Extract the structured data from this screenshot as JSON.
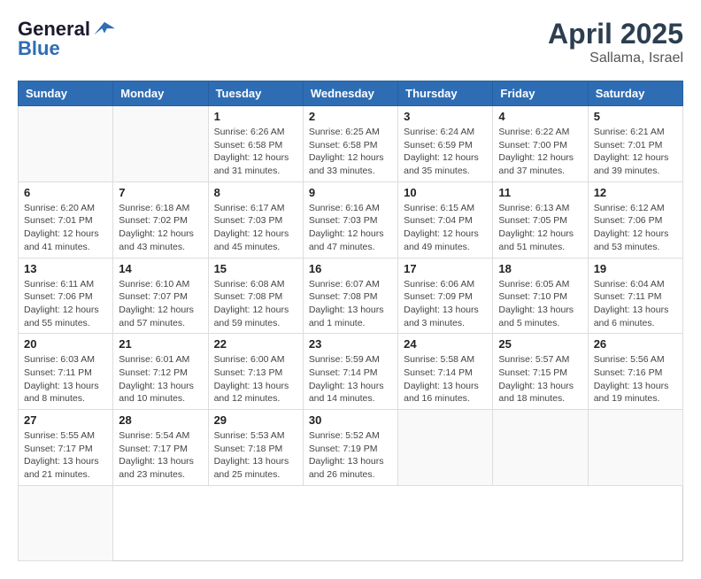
{
  "logo": {
    "general": "General",
    "blue": "Blue"
  },
  "header": {
    "month": "April 2025",
    "location": "Sallama, Israel"
  },
  "weekdays": [
    "Sunday",
    "Monday",
    "Tuesday",
    "Wednesday",
    "Thursday",
    "Friday",
    "Saturday"
  ],
  "days": [
    {
      "date": null,
      "info": null
    },
    {
      "date": null,
      "info": null
    },
    {
      "date": "1",
      "info": "Sunrise: 6:26 AM\nSunset: 6:58 PM\nDaylight: 12 hours\nand 31 minutes."
    },
    {
      "date": "2",
      "info": "Sunrise: 6:25 AM\nSunset: 6:58 PM\nDaylight: 12 hours\nand 33 minutes."
    },
    {
      "date": "3",
      "info": "Sunrise: 6:24 AM\nSunset: 6:59 PM\nDaylight: 12 hours\nand 35 minutes."
    },
    {
      "date": "4",
      "info": "Sunrise: 6:22 AM\nSunset: 7:00 PM\nDaylight: 12 hours\nand 37 minutes."
    },
    {
      "date": "5",
      "info": "Sunrise: 6:21 AM\nSunset: 7:01 PM\nDaylight: 12 hours\nand 39 minutes."
    },
    {
      "date": "6",
      "info": "Sunrise: 6:20 AM\nSunset: 7:01 PM\nDaylight: 12 hours\nand 41 minutes."
    },
    {
      "date": "7",
      "info": "Sunrise: 6:18 AM\nSunset: 7:02 PM\nDaylight: 12 hours\nand 43 minutes."
    },
    {
      "date": "8",
      "info": "Sunrise: 6:17 AM\nSunset: 7:03 PM\nDaylight: 12 hours\nand 45 minutes."
    },
    {
      "date": "9",
      "info": "Sunrise: 6:16 AM\nSunset: 7:03 PM\nDaylight: 12 hours\nand 47 minutes."
    },
    {
      "date": "10",
      "info": "Sunrise: 6:15 AM\nSunset: 7:04 PM\nDaylight: 12 hours\nand 49 minutes."
    },
    {
      "date": "11",
      "info": "Sunrise: 6:13 AM\nSunset: 7:05 PM\nDaylight: 12 hours\nand 51 minutes."
    },
    {
      "date": "12",
      "info": "Sunrise: 6:12 AM\nSunset: 7:06 PM\nDaylight: 12 hours\nand 53 minutes."
    },
    {
      "date": "13",
      "info": "Sunrise: 6:11 AM\nSunset: 7:06 PM\nDaylight: 12 hours\nand 55 minutes."
    },
    {
      "date": "14",
      "info": "Sunrise: 6:10 AM\nSunset: 7:07 PM\nDaylight: 12 hours\nand 57 minutes."
    },
    {
      "date": "15",
      "info": "Sunrise: 6:08 AM\nSunset: 7:08 PM\nDaylight: 12 hours\nand 59 minutes."
    },
    {
      "date": "16",
      "info": "Sunrise: 6:07 AM\nSunset: 7:08 PM\nDaylight: 13 hours\nand 1 minute."
    },
    {
      "date": "17",
      "info": "Sunrise: 6:06 AM\nSunset: 7:09 PM\nDaylight: 13 hours\nand 3 minutes."
    },
    {
      "date": "18",
      "info": "Sunrise: 6:05 AM\nSunset: 7:10 PM\nDaylight: 13 hours\nand 5 minutes."
    },
    {
      "date": "19",
      "info": "Sunrise: 6:04 AM\nSunset: 7:11 PM\nDaylight: 13 hours\nand 6 minutes."
    },
    {
      "date": "20",
      "info": "Sunrise: 6:03 AM\nSunset: 7:11 PM\nDaylight: 13 hours\nand 8 minutes."
    },
    {
      "date": "21",
      "info": "Sunrise: 6:01 AM\nSunset: 7:12 PM\nDaylight: 13 hours\nand 10 minutes."
    },
    {
      "date": "22",
      "info": "Sunrise: 6:00 AM\nSunset: 7:13 PM\nDaylight: 13 hours\nand 12 minutes."
    },
    {
      "date": "23",
      "info": "Sunrise: 5:59 AM\nSunset: 7:14 PM\nDaylight: 13 hours\nand 14 minutes."
    },
    {
      "date": "24",
      "info": "Sunrise: 5:58 AM\nSunset: 7:14 PM\nDaylight: 13 hours\nand 16 minutes."
    },
    {
      "date": "25",
      "info": "Sunrise: 5:57 AM\nSunset: 7:15 PM\nDaylight: 13 hours\nand 18 minutes."
    },
    {
      "date": "26",
      "info": "Sunrise: 5:56 AM\nSunset: 7:16 PM\nDaylight: 13 hours\nand 19 minutes."
    },
    {
      "date": "27",
      "info": "Sunrise: 5:55 AM\nSunset: 7:17 PM\nDaylight: 13 hours\nand 21 minutes."
    },
    {
      "date": "28",
      "info": "Sunrise: 5:54 AM\nSunset: 7:17 PM\nDaylight: 13 hours\nand 23 minutes."
    },
    {
      "date": "29",
      "info": "Sunrise: 5:53 AM\nSunset: 7:18 PM\nDaylight: 13 hours\nand 25 minutes."
    },
    {
      "date": "30",
      "info": "Sunrise: 5:52 AM\nSunset: 7:19 PM\nDaylight: 13 hours\nand 26 minutes."
    },
    {
      "date": null,
      "info": null
    },
    {
      "date": null,
      "info": null
    },
    {
      "date": null,
      "info": null
    },
    {
      "date": null,
      "info": null
    }
  ]
}
